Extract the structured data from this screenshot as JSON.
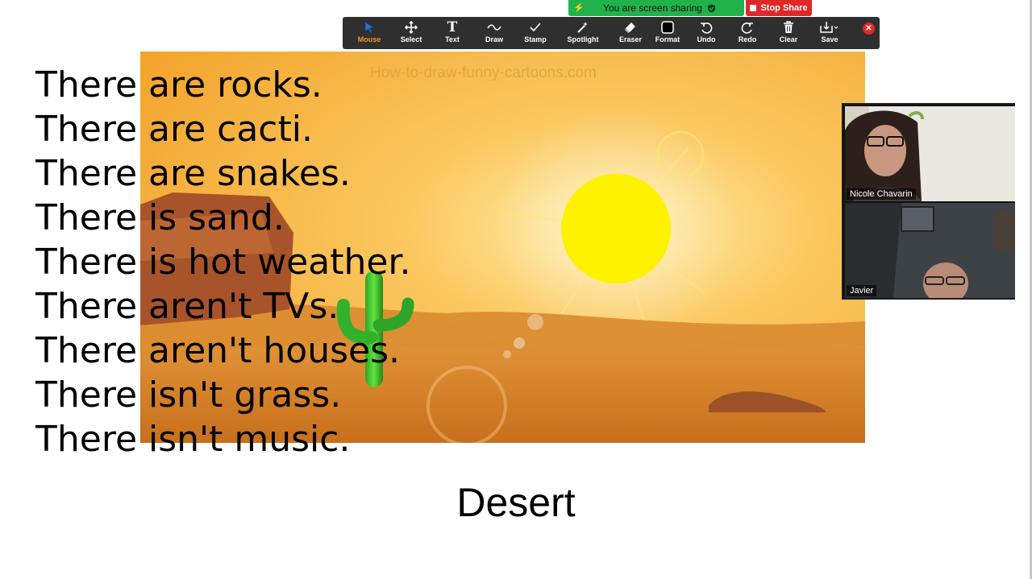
{
  "share_banner": {
    "label": "You are screen sharing",
    "stop_label": "Stop Share"
  },
  "toolbar": {
    "tools": [
      {
        "label": "Mouse",
        "icon": "mouse-pointer-icon",
        "active": true
      },
      {
        "label": "Select",
        "icon": "move-arrows-icon"
      },
      {
        "label": "Text",
        "icon": "text-t-icon"
      },
      {
        "label": "Draw",
        "icon": "squiggle-icon"
      },
      {
        "label": "Stamp",
        "icon": "checkmark-icon"
      },
      {
        "label": "Spotlight",
        "icon": "magic-wand-icon"
      },
      {
        "label": "Eraser",
        "icon": "eraser-icon"
      },
      {
        "label": "Format",
        "icon": "format-square-icon"
      },
      {
        "label": "Undo",
        "icon": "undo-icon"
      },
      {
        "label": "Redo",
        "icon": "redo-icon"
      },
      {
        "label": "Clear",
        "icon": "trash-icon"
      },
      {
        "label": "Save",
        "icon": "save-download-icon"
      }
    ],
    "close_icon": "close-icon",
    "active_color": "#f29a1a"
  },
  "slide": {
    "watermark": "How-to-draw-funny-cartoons.com",
    "sentences": [
      "There are rocks.",
      "There are cacti.",
      "There are snakes.",
      "There is sand.",
      "There is hot weather.",
      "There aren't TVs.",
      "There aren't houses.",
      "There isn't grass.",
      "There isn't music."
    ],
    "title": "Desert"
  },
  "participants": [
    {
      "name": "Nicole Chavarin"
    },
    {
      "name": "Javier"
    }
  ]
}
